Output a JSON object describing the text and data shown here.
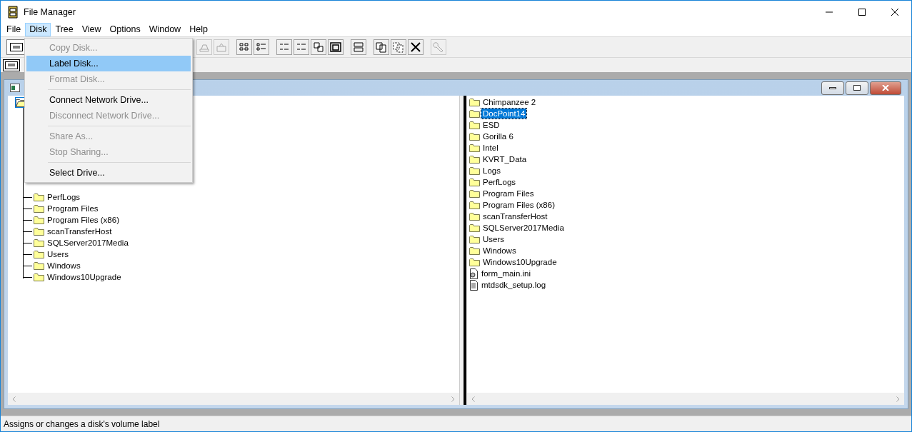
{
  "window": {
    "title": "File Manager"
  },
  "menu_bar": [
    {
      "label": "File",
      "selected": false
    },
    {
      "label": "Disk",
      "selected": true
    },
    {
      "label": "Tree",
      "selected": false
    },
    {
      "label": "View",
      "selected": false
    },
    {
      "label": "Options",
      "selected": false
    },
    {
      "label": "Window",
      "selected": false
    },
    {
      "label": "Help",
      "selected": false
    }
  ],
  "disk_menu": [
    {
      "kind": "item",
      "label": "Copy Disk...",
      "disabled": true,
      "selected": false
    },
    {
      "kind": "item",
      "label": "Label Disk...",
      "disabled": false,
      "selected": true
    },
    {
      "kind": "item",
      "label": "Format Disk...",
      "disabled": true,
      "selected": false
    },
    {
      "kind": "separator"
    },
    {
      "kind": "item",
      "label": "Connect Network Drive...",
      "disabled": false,
      "selected": false
    },
    {
      "kind": "item",
      "label": "Disconnect Network Drive...",
      "disabled": true,
      "selected": false
    },
    {
      "kind": "separator"
    },
    {
      "kind": "item",
      "label": "Share As...",
      "disabled": true,
      "selected": false
    },
    {
      "kind": "item",
      "label": "Stop Sharing...",
      "disabled": true,
      "selected": false
    },
    {
      "kind": "separator"
    },
    {
      "kind": "item",
      "label": "Select Drive...",
      "disabled": false,
      "selected": false
    }
  ],
  "toolbar": [
    {
      "kind": "connect",
      "disabled": true
    },
    {
      "kind": "share",
      "disabled": true
    },
    {
      "kind": "gap"
    },
    {
      "kind": "large-icons",
      "disabled": false
    },
    {
      "kind": "details",
      "disabled": false
    },
    {
      "kind": "gap"
    },
    {
      "kind": "sort-name",
      "disabled": false
    },
    {
      "kind": "sort-type",
      "disabled": false
    },
    {
      "kind": "sort-size",
      "disabled": false
    },
    {
      "kind": "sort-date",
      "disabled": false
    },
    {
      "kind": "gap"
    },
    {
      "kind": "new-window",
      "disabled": false
    },
    {
      "kind": "gap"
    },
    {
      "kind": "copy",
      "disabled": false
    },
    {
      "kind": "move",
      "disabled": false
    },
    {
      "kind": "delete",
      "disabled": false
    },
    {
      "kind": "gap"
    },
    {
      "kind": "key",
      "disabled": true
    }
  ],
  "tree": {
    "children": [
      {
        "label": "PerfLogs"
      },
      {
        "label": "Program Files"
      },
      {
        "label": "Program Files (x86)"
      },
      {
        "label": "scanTransferHost"
      },
      {
        "label": "SQLServer2017Media"
      },
      {
        "label": "Users"
      },
      {
        "label": "Windows"
      },
      {
        "label": "Windows10Upgrade"
      }
    ]
  },
  "files": [
    {
      "kind": "folder",
      "name": "Chimpanzee 2",
      "selected": false
    },
    {
      "kind": "folder",
      "name": "DocPoint14",
      "selected": true
    },
    {
      "kind": "folder",
      "name": "ESD",
      "selected": false
    },
    {
      "kind": "folder",
      "name": "Gorilla 6",
      "selected": false
    },
    {
      "kind": "folder",
      "name": "Intel",
      "selected": false
    },
    {
      "kind": "folder",
      "name": "KVRT_Data",
      "selected": false
    },
    {
      "kind": "folder",
      "name": "Logs",
      "selected": false
    },
    {
      "kind": "folder",
      "name": "PerfLogs",
      "selected": false
    },
    {
      "kind": "folder",
      "name": "Program Files",
      "selected": false
    },
    {
      "kind": "folder",
      "name": "Program Files (x86)",
      "selected": false
    },
    {
      "kind": "folder",
      "name": "scanTransferHost",
      "selected": false
    },
    {
      "kind": "folder",
      "name": "SQLServer2017Media",
      "selected": false
    },
    {
      "kind": "folder",
      "name": "Users",
      "selected": false
    },
    {
      "kind": "folder",
      "name": "Windows",
      "selected": false
    },
    {
      "kind": "folder",
      "name": "Windows10Upgrade",
      "selected": false
    },
    {
      "kind": "settings-file",
      "name": "form_main.ini",
      "selected": false
    },
    {
      "kind": "text-file",
      "name": "mtdsdk_setup.log",
      "selected": false
    }
  ],
  "status_bar": {
    "text": "Assigns or changes a disk's volume label"
  }
}
